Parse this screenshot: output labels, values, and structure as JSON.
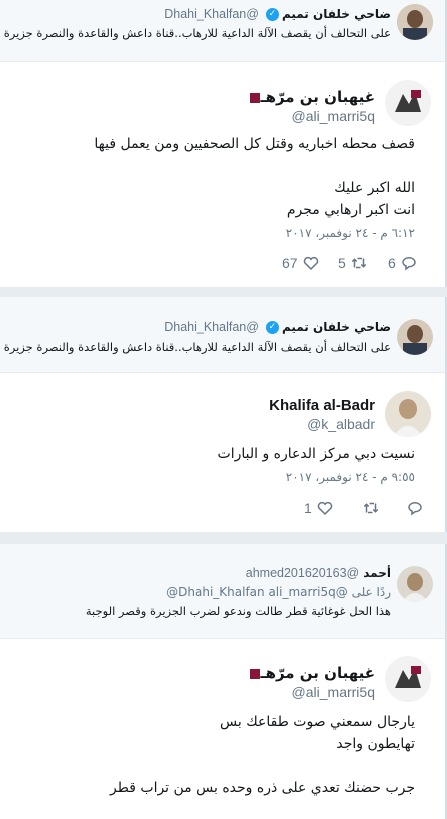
{
  "colors": {
    "accent": "#1da1f2",
    "flag": "#8a1538"
  },
  "tweet1": {
    "quoted": {
      "name": "ضاحي خلفان تميم",
      "handle": "@Dhahi_Khalfan",
      "text": "على التحالف أن يقصف الآلة الداعية للارهاب..قناة داعش والقاعدة والنصرة جزيرة الا"
    },
    "author": {
      "name": "غيهبان بن مرّهـ",
      "handle": "@ali_marri5q"
    },
    "lines": [
      "قصف محطه اخباريه وقتل كل الصحفيين ومن يعمل فيها",
      "الله اكبر عليك",
      "انت اكبر ارهابي مجرم"
    ],
    "time": "٦:١٢ م - ٢٤ نوفمبر، ٢٠١٧",
    "likes": "67",
    "retweets": "5",
    "replies": "6"
  },
  "tweet2": {
    "quoted": {
      "name": "ضاحي خلفان تميم",
      "handle": "@Dhahi_Khalfan",
      "text": "على التحالف أن يقصف الآلة الداعية للارهاب..قناة داعش والقاعدة والنصرة جزيرة الا"
    },
    "author": {
      "name": "Khalifa al-Badr",
      "handle": "@k_albadr"
    },
    "lines": [
      "نسيت دبي مركز الدعاره و البارات"
    ],
    "time": "٩:٥٥ م - ٢٤ نوفمبر، ٢٠١٧",
    "likes": "1",
    "retweets": "",
    "replies": ""
  },
  "tweet3": {
    "quoted": {
      "name": "أحمد",
      "handle": "@ahmed201620163",
      "reply_to": "ردًا على @Dhahi_Khalfan ali_marri5q@",
      "text": "هذا الحل غوغائية قطر طالت وندعو لضرب الجزيرة وقصر الوجبة"
    },
    "author": {
      "name": "غيهبان بن مرّهـ",
      "handle": "@ali_marri5q"
    },
    "lines": [
      "يارجال سمعني صوت طقاعك بس",
      "تهايطون واجد",
      "جرب حضنك تعدي على ذره وحده بس من تراب قطر"
    ]
  }
}
